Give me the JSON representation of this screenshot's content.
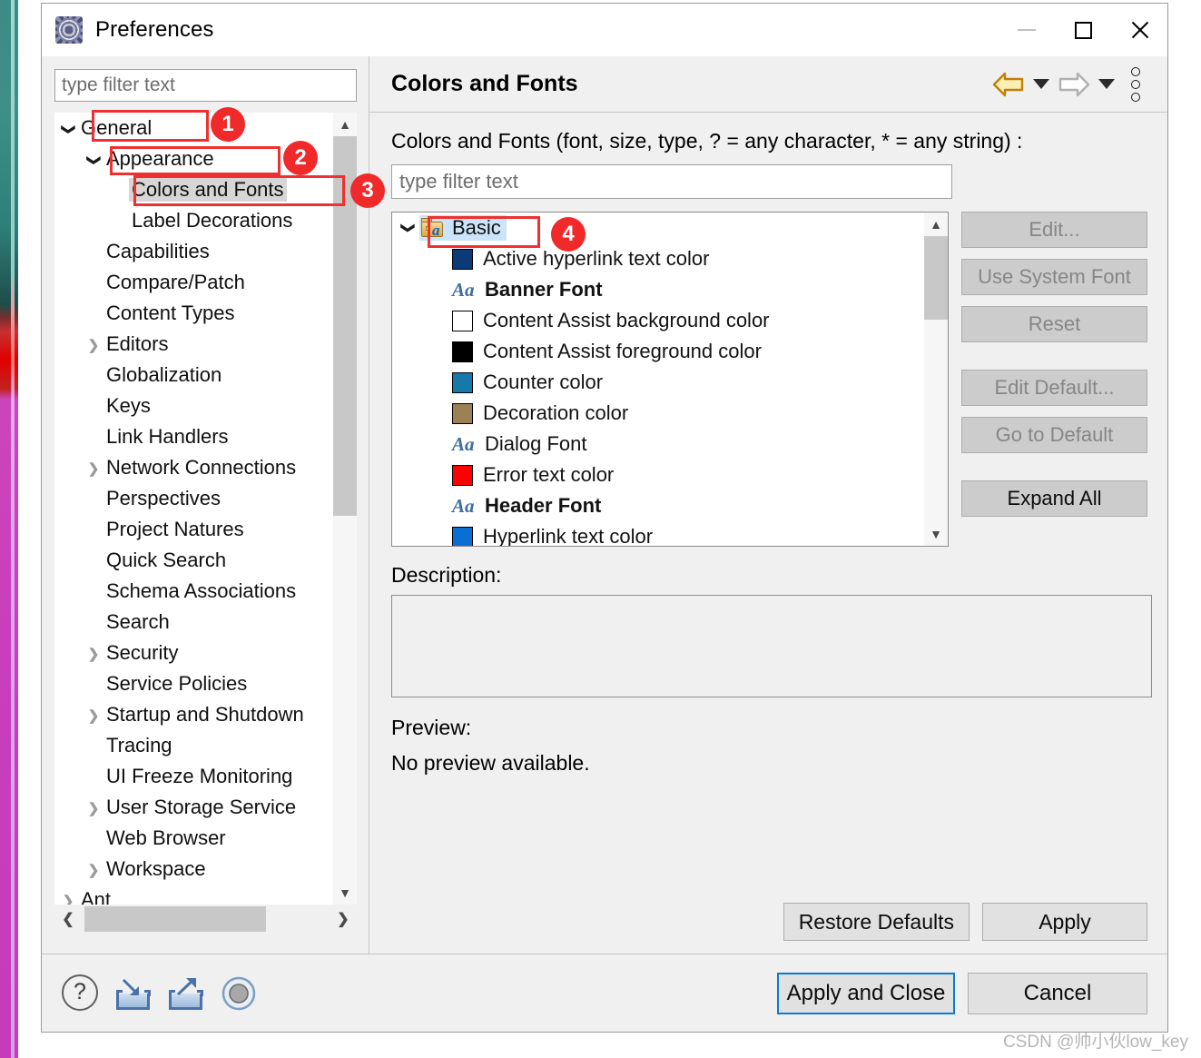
{
  "window": {
    "title": "Preferences",
    "icon": "preferences-gear-icon",
    "controls": {
      "minimize": "minimize-icon",
      "maximize": "maximize-icon",
      "close": "close-icon"
    }
  },
  "left_pane": {
    "filter": {
      "placeholder": "type filter text",
      "value": ""
    },
    "tree": [
      {
        "label": "General",
        "indent": 0,
        "twisty": "open",
        "selected": false
      },
      {
        "label": "Appearance",
        "indent": 1,
        "twisty": "open",
        "selected": false
      },
      {
        "label": "Colors and Fonts",
        "indent": 2,
        "twisty": "none",
        "selected": true
      },
      {
        "label": "Label Decorations",
        "indent": 2,
        "twisty": "none",
        "selected": false
      },
      {
        "label": "Capabilities",
        "indent": 1,
        "twisty": "none",
        "selected": false
      },
      {
        "label": "Compare/Patch",
        "indent": 1,
        "twisty": "none",
        "selected": false
      },
      {
        "label": "Content Types",
        "indent": 1,
        "twisty": "none",
        "selected": false
      },
      {
        "label": "Editors",
        "indent": 1,
        "twisty": "closed",
        "selected": false
      },
      {
        "label": "Globalization",
        "indent": 1,
        "twisty": "none",
        "selected": false
      },
      {
        "label": "Keys",
        "indent": 1,
        "twisty": "none",
        "selected": false
      },
      {
        "label": "Link Handlers",
        "indent": 1,
        "twisty": "none",
        "selected": false
      },
      {
        "label": "Network Connections",
        "indent": 1,
        "twisty": "closed",
        "selected": false
      },
      {
        "label": "Perspectives",
        "indent": 1,
        "twisty": "none",
        "selected": false
      },
      {
        "label": "Project Natures",
        "indent": 1,
        "twisty": "none",
        "selected": false
      },
      {
        "label": "Quick Search",
        "indent": 1,
        "twisty": "none",
        "selected": false
      },
      {
        "label": "Schema Associations",
        "indent": 1,
        "twisty": "none",
        "selected": false
      },
      {
        "label": "Search",
        "indent": 1,
        "twisty": "none",
        "selected": false
      },
      {
        "label": "Security",
        "indent": 1,
        "twisty": "closed",
        "selected": false
      },
      {
        "label": "Service Policies",
        "indent": 1,
        "twisty": "none",
        "selected": false
      },
      {
        "label": "Startup and Shutdown",
        "indent": 1,
        "twisty": "closed",
        "selected": false
      },
      {
        "label": "Tracing",
        "indent": 1,
        "twisty": "none",
        "selected": false
      },
      {
        "label": "UI Freeze Monitoring",
        "indent": 1,
        "twisty": "none",
        "selected": false
      },
      {
        "label": "User Storage Service",
        "indent": 1,
        "twisty": "closed",
        "selected": false
      },
      {
        "label": "Web Browser",
        "indent": 1,
        "twisty": "none",
        "selected": false
      },
      {
        "label": "Workspace",
        "indent": 1,
        "twisty": "closed",
        "selected": false
      },
      {
        "label": "Ant",
        "indent": 0,
        "twisty": "closed",
        "selected": false
      }
    ],
    "scrollbar": {
      "up_arrow": "chevron-up-icon",
      "down_arrow": "chevron-down-icon",
      "left_arrow": "chevron-left-icon",
      "right_arrow": "chevron-right-icon"
    }
  },
  "right_pane": {
    "page_title": "Colors and Fonts",
    "nav": {
      "back_icon": "back-arrow-icon",
      "back_menu_icon": "chevron-down-icon",
      "forward_icon": "forward-arrow-icon",
      "forward_menu_icon": "chevron-down-icon",
      "menu_icon": "vertical-dots-menu-icon"
    },
    "description_line": "Colors and Fonts (font, size, type, ? = any character, * = any string) :",
    "filter": {
      "placeholder": "type filter text",
      "value": ""
    },
    "list": [
      {
        "label": "Basic",
        "kind": "group",
        "icon": "folder-font-icon",
        "selected": true,
        "bold": false
      },
      {
        "label": "Active hyperlink text color",
        "kind": "color",
        "color": "#0c3a78",
        "bold": false
      },
      {
        "label": "Banner Font",
        "kind": "font",
        "icon": "Aa",
        "bold": true
      },
      {
        "label": "Content Assist background color",
        "kind": "color",
        "color": "#ffffff",
        "bold": false
      },
      {
        "label": "Content Assist foreground color",
        "kind": "color",
        "color": "#000000",
        "bold": false
      },
      {
        "label": "Counter color",
        "kind": "color",
        "color": "#157aa8",
        "bold": false
      },
      {
        "label": "Decoration color",
        "kind": "color",
        "color": "#9b8154",
        "bold": false
      },
      {
        "label": "Dialog Font",
        "kind": "font",
        "icon": "Aa",
        "bold": false
      },
      {
        "label": "Error text color",
        "kind": "color",
        "color": "#ff0000",
        "bold": false
      },
      {
        "label": "Header Font",
        "kind": "font",
        "icon": "Aa",
        "bold": true
      },
      {
        "label": "Hyperlink text color",
        "kind": "color",
        "color": "#0a6fd4",
        "bold": false
      }
    ],
    "side_buttons": [
      {
        "label": "Edit...",
        "enabled": false
      },
      {
        "label": "Use System Font",
        "enabled": false
      },
      {
        "label": "Reset",
        "enabled": false
      },
      {
        "label": "Edit Default...",
        "enabled": false
      },
      {
        "label": "Go to Default",
        "enabled": false
      },
      {
        "label": "Expand All",
        "enabled": true
      }
    ],
    "description_label": "Description:",
    "description_value": "",
    "preview_label": "Preview:",
    "preview_value": "No preview available.",
    "restore_defaults_label": "Restore Defaults",
    "apply_label": "Apply"
  },
  "footer": {
    "icons": [
      {
        "name": "help-icon",
        "glyph": "?"
      },
      {
        "name": "import-icon",
        "glyph": ""
      },
      {
        "name": "export-icon",
        "glyph": ""
      },
      {
        "name": "record-icon",
        "glyph": ""
      }
    ],
    "apply_and_close_label": "Apply and Close",
    "cancel_label": "Cancel"
  },
  "annotations": [
    {
      "badge": "1",
      "target": "General"
    },
    {
      "badge": "2",
      "target": "Appearance"
    },
    {
      "badge": "3",
      "target": "Colors and Fonts"
    },
    {
      "badge": "4",
      "target": "Basic"
    }
  ],
  "watermark": "CSDN @帅小伙low_key",
  "colors": {
    "accent_selection": "#cce4f7",
    "annotation_red": "#f02a2a",
    "focus_blue": "#0a7cd1",
    "dialog_bg": "#f0f0f0"
  }
}
